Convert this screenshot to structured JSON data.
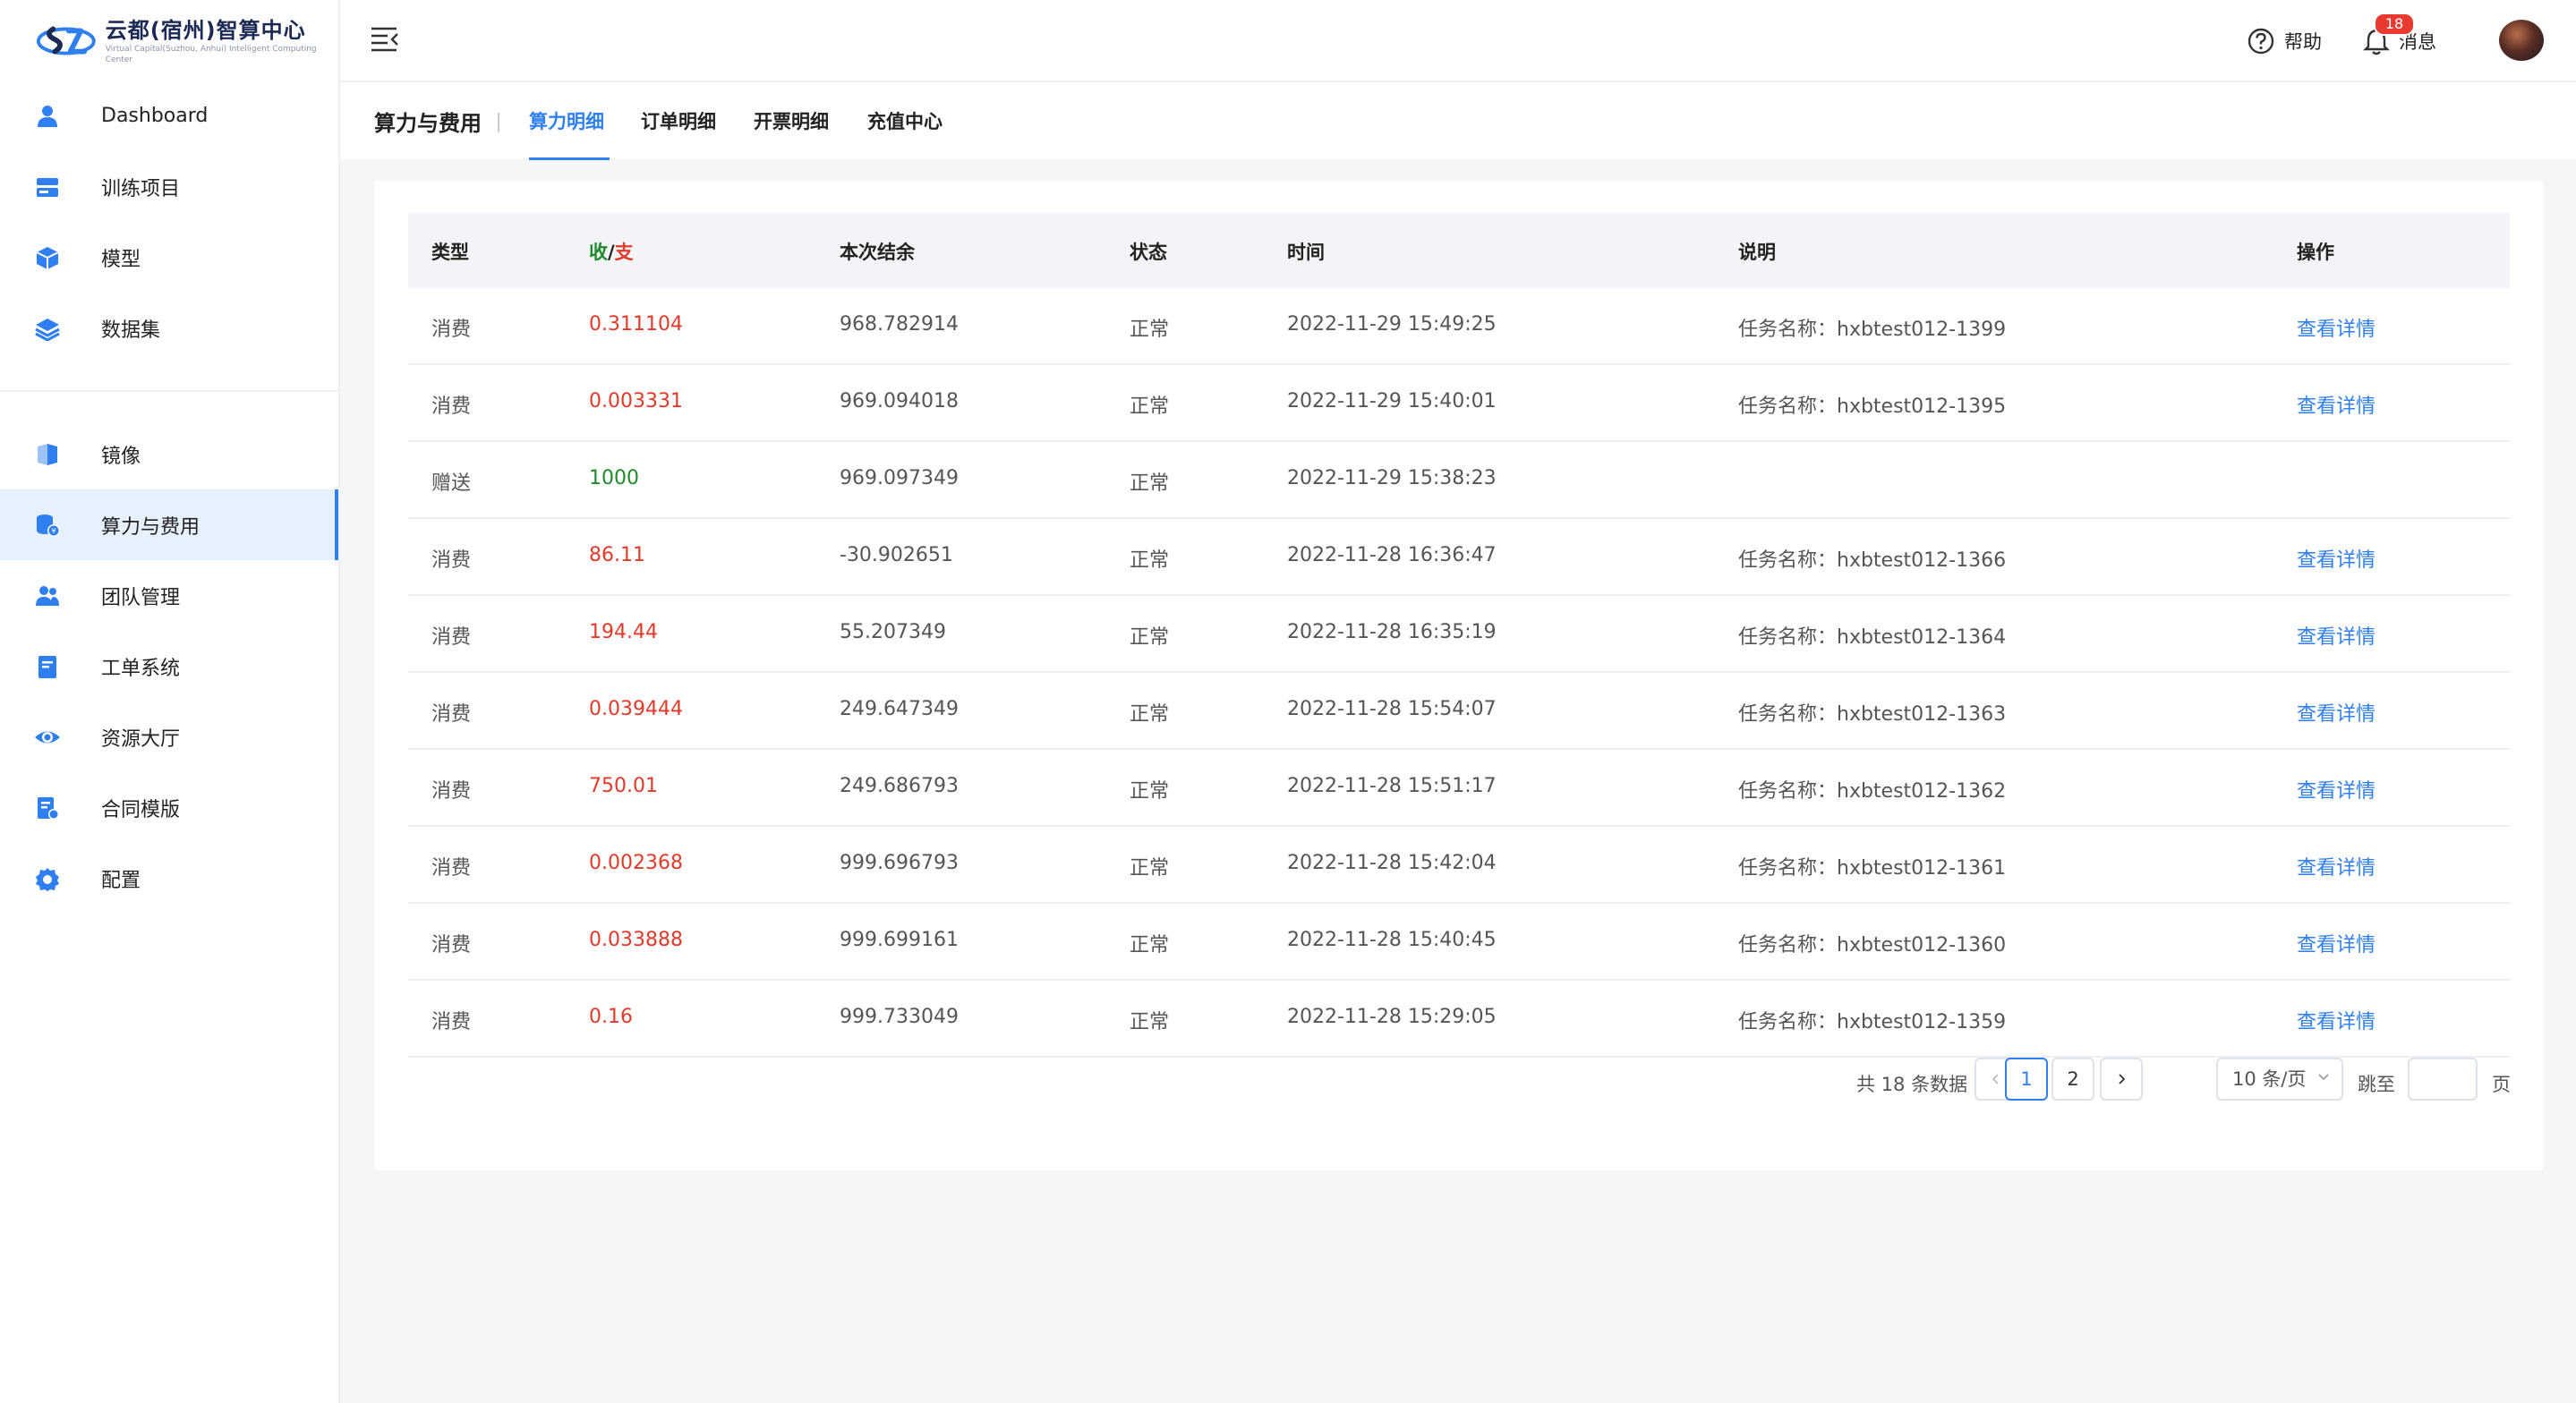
{
  "brand": {
    "title": "云都(宿州)智算中心",
    "subtitle": "Virtual Capital(Suzhou, Anhui) Intelligent Computing Center",
    "colors": {
      "primary": "#2f7ff0",
      "dark": "#1b2a55"
    }
  },
  "sidebar": {
    "items": [
      {
        "label": "Dashboard",
        "icon": "user-icon"
      },
      {
        "label": "训练项目",
        "icon": "server-icon"
      },
      {
        "label": "模型",
        "icon": "cube-icon"
      },
      {
        "label": "数据集",
        "icon": "layers-icon"
      },
      {
        "label": "镜像",
        "icon": "mirror-icon"
      },
      {
        "label": "算力与费用",
        "icon": "billing-icon",
        "active": true
      },
      {
        "label": "团队管理",
        "icon": "team-icon"
      },
      {
        "label": "工单系统",
        "icon": "ticket-icon"
      },
      {
        "label": "资源大厅",
        "icon": "eye-icon"
      },
      {
        "label": "合同模版",
        "icon": "contract-icon"
      },
      {
        "label": "配置",
        "icon": "gear-icon"
      }
    ]
  },
  "header": {
    "help_label": "帮助",
    "messages_label": "消息",
    "messages_count": "18"
  },
  "subnav": {
    "title": "算力与费用",
    "tabs": [
      {
        "label": "算力明细",
        "active": true
      },
      {
        "label": "订单明细"
      },
      {
        "label": "开票明细"
      },
      {
        "label": "充值中心"
      }
    ]
  },
  "table": {
    "headers": {
      "type": "类型",
      "income": "收",
      "slash": "/",
      "expense": "支",
      "balance": "本次结余",
      "status": "状态",
      "time": "时间",
      "desc": "说明",
      "action": "操作"
    },
    "rows": [
      {
        "type": "消费",
        "amount": "0.311104",
        "balance": "968.782914",
        "status": "正常",
        "time": "2022-11-29 15:49:25",
        "desc": "任务名称：hxbtest012-1399",
        "action": "查看详情",
        "kind": "expense"
      },
      {
        "type": "消费",
        "amount": "0.003331",
        "balance": "969.094018",
        "status": "正常",
        "time": "2022-11-29 15:40:01",
        "desc": "任务名称：hxbtest012-1395",
        "action": "查看详情",
        "kind": "expense"
      },
      {
        "type": "赠送",
        "amount": "1000",
        "balance": "969.097349",
        "status": "正常",
        "time": "2022-11-29 15:38:23",
        "desc": "",
        "action": "",
        "kind": "income"
      },
      {
        "type": "消费",
        "amount": "86.11",
        "balance": "-30.902651",
        "status": "正常",
        "time": "2022-11-28 16:36:47",
        "desc": "任务名称：hxbtest012-1366",
        "action": "查看详情",
        "kind": "expense"
      },
      {
        "type": "消费",
        "amount": "194.44",
        "balance": "55.207349",
        "status": "正常",
        "time": "2022-11-28 16:35:19",
        "desc": "任务名称：hxbtest012-1364",
        "action": "查看详情",
        "kind": "expense"
      },
      {
        "type": "消费",
        "amount": "0.039444",
        "balance": "249.647349",
        "status": "正常",
        "time": "2022-11-28 15:54:07",
        "desc": "任务名称：hxbtest012-1363",
        "action": "查看详情",
        "kind": "expense"
      },
      {
        "type": "消费",
        "amount": "750.01",
        "balance": "249.686793",
        "status": "正常",
        "time": "2022-11-28 15:51:17",
        "desc": "任务名称：hxbtest012-1362",
        "action": "查看详情",
        "kind": "expense"
      },
      {
        "type": "消费",
        "amount": "0.002368",
        "balance": "999.696793",
        "status": "正常",
        "time": "2022-11-28 15:42:04",
        "desc": "任务名称：hxbtest012-1361",
        "action": "查看详情",
        "kind": "expense"
      },
      {
        "type": "消费",
        "amount": "0.033888",
        "balance": "999.699161",
        "status": "正常",
        "time": "2022-11-28 15:40:45",
        "desc": "任务名称：hxbtest012-1360",
        "action": "查看详情",
        "kind": "expense"
      },
      {
        "type": "消费",
        "amount": "0.16",
        "balance": "999.733049",
        "status": "正常",
        "time": "2022-11-28 15:29:05",
        "desc": "任务名称：hxbtest012-1359",
        "action": "查看详情",
        "kind": "expense"
      }
    ]
  },
  "pagination": {
    "total_text": "共 18 条数据",
    "pages": [
      "1",
      "2"
    ],
    "current": "1",
    "page_size": "10 条/页",
    "jump_label": "跳至",
    "page_label": "页"
  }
}
